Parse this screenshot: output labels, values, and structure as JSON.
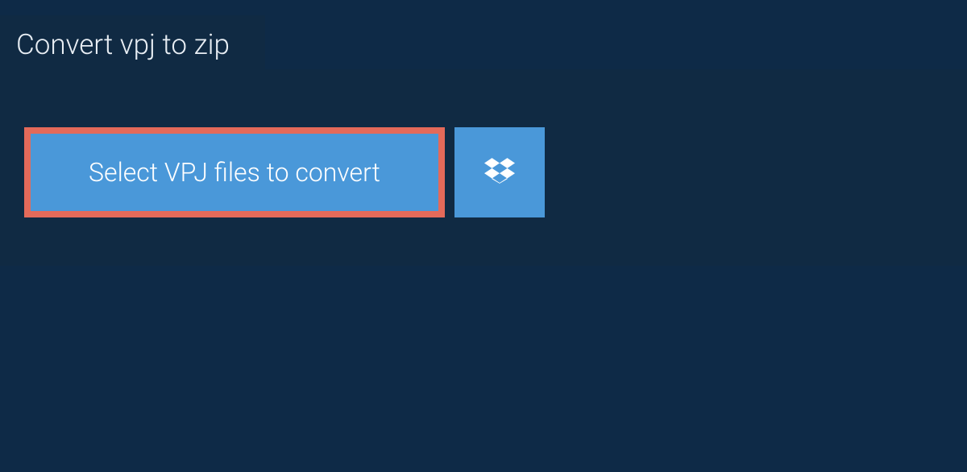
{
  "tab": {
    "title": "Convert vpj to zip"
  },
  "actions": {
    "select_files_label": "Select VPJ files to convert",
    "dropbox_icon": "dropbox-icon"
  },
  "colors": {
    "background": "#0e2a47",
    "panel": "#102a43",
    "button": "#4a98d9",
    "highlight_border": "#e46a5a",
    "text": "#ffffff"
  }
}
